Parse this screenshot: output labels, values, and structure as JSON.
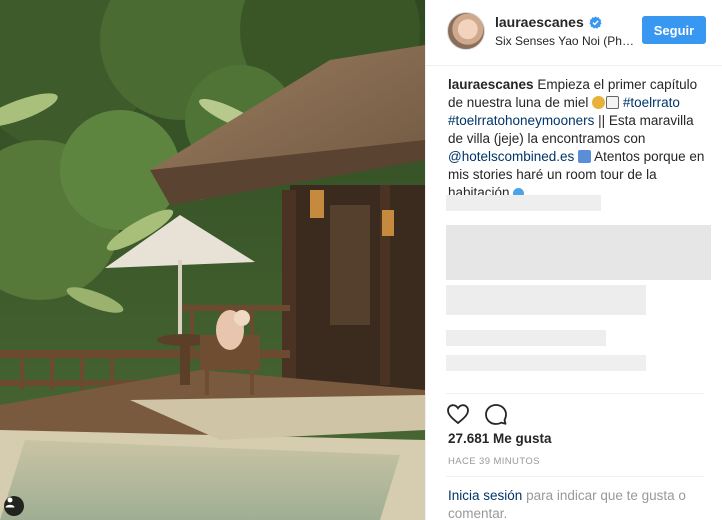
{
  "post": {
    "username": "lauraescanes",
    "location": "Six Senses Yao Noi (Ph…",
    "follow_label": "Seguir",
    "caption": {
      "username": "lauraescanes",
      "text_1": "Empieza el primer capítulo de nuestra luna de miel",
      "hashtag_1": "#toelrrato",
      "hashtag_2": "#toelrratohoneymooners",
      "text_2": "|| Esta maravilla de villa (jeje) la encontramos con",
      "mention": "@hotelscombined.es",
      "text_3": "Atentos porque en mis stories haré un room tour de la habitación"
    },
    "likes": "27.681 Me gusta",
    "time": "HACE 39 MINUTOS",
    "login": {
      "link": "Inicia sesión",
      "text": "para indicar que te gusta o comentar."
    }
  },
  "icons": {
    "verified": "verified-badge-icon",
    "like": "heart-icon",
    "comment": "comment-icon",
    "user_tag": "user-tag-icon"
  },
  "colors": {
    "accent": "#3897f0",
    "link": "#003569",
    "muted": "#999999",
    "text": "#262626"
  }
}
